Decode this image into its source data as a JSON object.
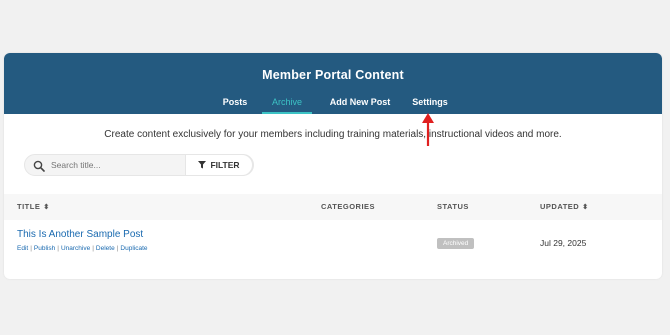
{
  "header": {
    "title": "Member Portal Content",
    "tabs": [
      {
        "label": "Posts"
      },
      {
        "label": "Archive"
      },
      {
        "label": "Add New Post"
      },
      {
        "label": "Settings"
      }
    ],
    "active_tab": "Archive"
  },
  "description": "Create content exclusively for your members including training materials, instructional videos and more.",
  "search": {
    "placeholder": "Search title...",
    "icon": "search-icon"
  },
  "filter": {
    "label": "FILTER",
    "icon": "filter-icon"
  },
  "table": {
    "columns": [
      "TITLE",
      "CATEGORIES",
      "STATUS",
      "UPDATED"
    ],
    "rows": [
      {
        "title": "This Is Another Sample Post",
        "actions": [
          "Edit",
          "Publish",
          "Unarchive",
          "Delete",
          "Duplicate"
        ],
        "categories": "",
        "status": "Archived",
        "updated": "Jul 29, 2025"
      }
    ]
  },
  "colors": {
    "header_bg": "#245a80",
    "active_tab": "#3cc3c5",
    "link": "#1a6ab0",
    "badge_bg": "#c0c0c0",
    "annotation_arrow": "#e02020"
  }
}
